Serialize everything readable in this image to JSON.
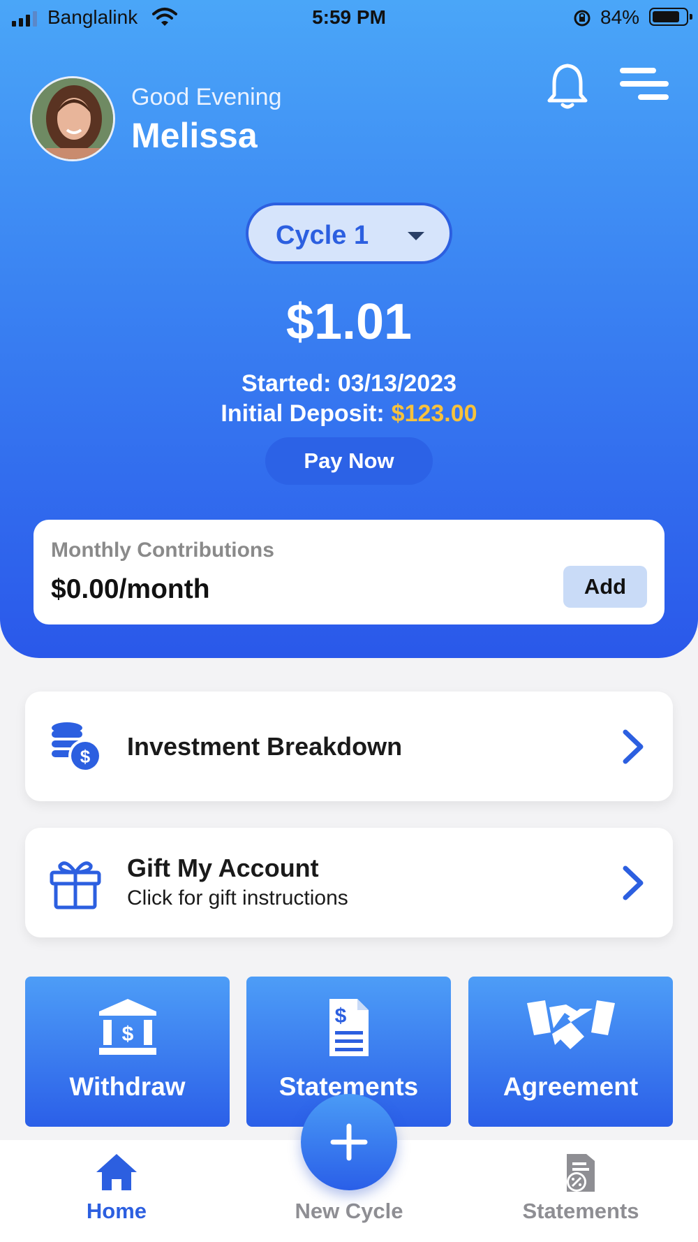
{
  "status_bar": {
    "carrier": "Banglalink",
    "time": "5:59 PM",
    "battery_percent": "84%",
    "battery_level": 0.84
  },
  "header": {
    "greeting": "Good Evening",
    "user_name": "Melissa",
    "icons": [
      "bell-icon",
      "menu-icon"
    ]
  },
  "cycle_selector": {
    "label": "Cycle 1"
  },
  "summary": {
    "balance": "$1.01",
    "started": "Started: 03/13/2023",
    "initial_deposit_label": "Initial Deposit:",
    "initial_deposit_value": "$123.00",
    "pay_now_label": "Pay Now"
  },
  "monthly": {
    "title": "Monthly Contributions",
    "value": "$0.00/month",
    "add_label": "Add"
  },
  "cards": {
    "investment": {
      "title": "Investment Breakdown",
      "icon": "coins-dollar-icon"
    },
    "gift": {
      "title": "Gift My Account",
      "subtitle": "Click for gift  instructions",
      "icon": "gift-icon"
    }
  },
  "tiles": {
    "withdraw": "Withdraw",
    "statements": "Statements",
    "agreement": "Agreement"
  },
  "tabbar": {
    "home": "Home",
    "new_cycle": "New Cycle",
    "statements": "Statements"
  },
  "colors": {
    "accent": "#2c5fe0",
    "gradient_top": "#4aa6f8",
    "gradient_bottom": "#2a58ea",
    "deposit_highlight": "#f7c23c",
    "inactive_tab": "#8e8e93"
  }
}
